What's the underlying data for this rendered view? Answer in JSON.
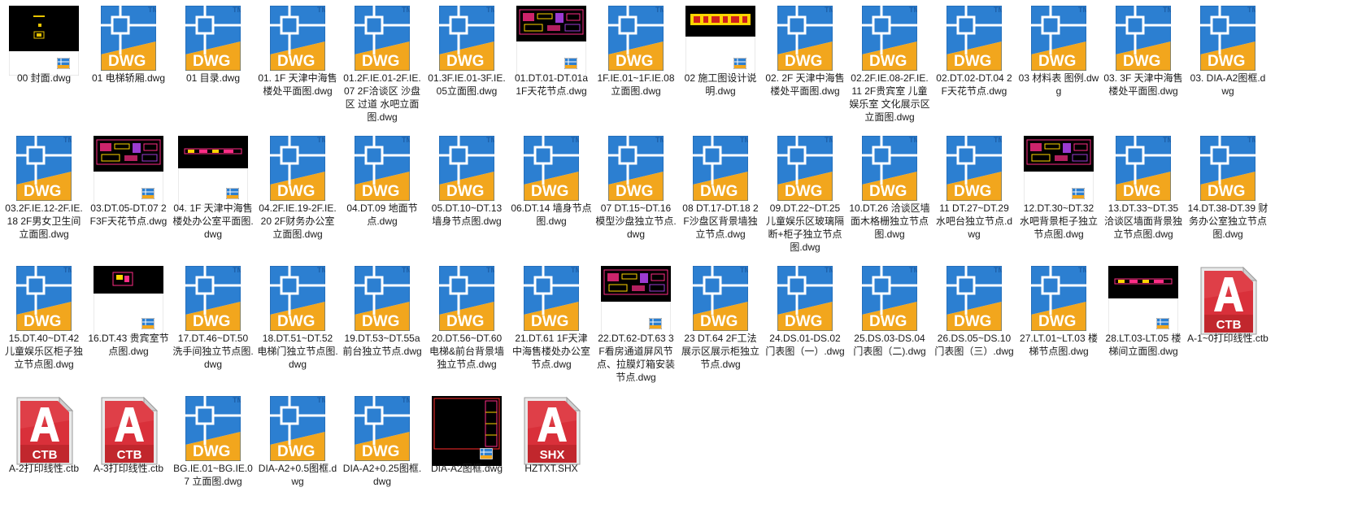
{
  "colors": {
    "dwg_blue": "#2c7fd1",
    "dwg_orange": "#f2a61d",
    "autocad_red": "#c1272d"
  },
  "files": [
    {
      "name": "00 封面.dwg",
      "icon": "preview-dwg-icon",
      "variant": "cover"
    },
    {
      "name": "01 电梯轿厢.dwg",
      "icon": "dwg-file-icon"
    },
    {
      "name": "01 目录.dwg",
      "icon": "dwg-file-icon"
    },
    {
      "name": "01. 1F 天津中海售楼处平面图.dwg",
      "icon": "dwg-file-icon"
    },
    {
      "name": "01.2F.IE.01-2F.IE.07 2F洽谈区 沙盘区 过道 水吧立面图.dwg",
      "icon": "dwg-file-icon"
    },
    {
      "name": "01.3F.IE.01-3F.IE.05立面图.dwg",
      "icon": "dwg-file-icon"
    },
    {
      "name": "01.DT.01-DT.01a 1F天花节点.dwg",
      "icon": "preview-dwg-icon",
      "variant": "boxes"
    },
    {
      "name": "1F.IE.01~1F.IE.08立面图.dwg",
      "icon": "dwg-file-icon"
    },
    {
      "name": "02 施工图设计说明.dwg",
      "icon": "preview-dwg-icon",
      "variant": "text"
    },
    {
      "name": "02. 2F 天津中海售楼处平面图.dwg",
      "icon": "dwg-file-icon"
    },
    {
      "name": "02.2F.IE.08-2F.IE.11 2F贵宾室 儿童娱乐室 文化展示区立面图.dwg",
      "icon": "dwg-file-icon"
    },
    {
      "name": "02.DT.02-DT.04 2F天花节点.dwg",
      "icon": "dwg-file-icon"
    },
    {
      "name": "03 材料表 图例.dwg",
      "icon": "dwg-file-icon"
    },
    {
      "name": "03. 3F 天津中海售楼处平面图.dwg",
      "icon": "dwg-file-icon"
    },
    {
      "name": "03. DIA-A2图框.dwg",
      "icon": "dwg-file-icon"
    },
    {
      "name": "03.2F.IE.12-2F.IE.18 2F男女卫生间立面图.dwg",
      "icon": "dwg-file-icon"
    },
    {
      "name": "03.DT.05-DT.07 2F3F天花节点.dwg",
      "icon": "preview-dwg-icon",
      "variant": "boxes"
    },
    {
      "name": "04. 1F 天津中海售楼处办公室平面图.dwg",
      "icon": "preview-dwg-icon",
      "variant": "strip"
    },
    {
      "name": "04.2F.IE.19-2F.IE.20 2F财务办公室 立面图.dwg",
      "icon": "dwg-file-icon"
    },
    {
      "name": "04.DT.09 地面节点.dwg",
      "icon": "dwg-file-icon"
    },
    {
      "name": "05.DT.10~DT.13 墙身节点图.dwg",
      "icon": "dwg-file-icon"
    },
    {
      "name": "06.DT.14 墙身节点图.dwg",
      "icon": "dwg-file-icon"
    },
    {
      "name": "07 DT.15~DT.16 模型沙盘独立节点.dwg",
      "icon": "dwg-file-icon"
    },
    {
      "name": "08 DT.17-DT.18 2F沙盘区背景墙独立节点.dwg",
      "icon": "dwg-file-icon"
    },
    {
      "name": "09.DT.22~DT.25 儿童娱乐区玻璃隔断+柜子独立节点图.dwg",
      "icon": "dwg-file-icon"
    },
    {
      "name": "10.DT.26 洽谈区墙面木格栅独立节点图.dwg",
      "icon": "dwg-file-icon"
    },
    {
      "name": "11 DT.27~DT.29 水吧台独立节点.dwg",
      "icon": "dwg-file-icon"
    },
    {
      "name": "12.DT.30~DT.32 水吧背景柜子独立节点图.dwg",
      "icon": "preview-dwg-icon",
      "variant": "boxes"
    },
    {
      "name": "13.DT.33~DT.35 洽谈区墙面背景独立节点图.dwg",
      "icon": "dwg-file-icon"
    },
    {
      "name": "14.DT.38-DT.39 财务办公室独立节点图.dwg",
      "icon": "dwg-file-icon"
    },
    {
      "name": "15.DT.40~DT.42 儿童娱乐区柜子独立节点图.dwg",
      "icon": "dwg-file-icon"
    },
    {
      "name": "16.DT.43 贵宾室节点图.dwg",
      "icon": "preview-dwg-icon",
      "variant": "small"
    },
    {
      "name": "17.DT.46~DT.50 洗手间独立节点图.dwg",
      "icon": "dwg-file-icon"
    },
    {
      "name": "18.DT.51~DT.52 电梯门独立节点图.dwg",
      "icon": "dwg-file-icon"
    },
    {
      "name": "19.DT.53~DT.55a 前台独立节点.dwg",
      "icon": "dwg-file-icon"
    },
    {
      "name": "20.DT.56~DT.60 电梯&前台背景墙独立节点.dwg",
      "icon": "dwg-file-icon"
    },
    {
      "name": "21.DT.61 1F天津中海售楼处办公室节点.dwg",
      "icon": "dwg-file-icon"
    },
    {
      "name": "22.DT.62-DT.63 3F看房通道屏风节点、拉膜灯箱安装节点.dwg",
      "icon": "preview-dwg-icon",
      "variant": "boxes"
    },
    {
      "name": "23 DT.64 2F工法展示区展示柜独立节点.dwg",
      "icon": "dwg-file-icon"
    },
    {
      "name": "24.DS.01-DS.02 门表图（一）.dwg",
      "icon": "dwg-file-icon"
    },
    {
      "name": "25.DS.03-DS.04 门表图（二).dwg",
      "icon": "dwg-file-icon"
    },
    {
      "name": "26.DS.05~DS.10 门表图（三）.dwg",
      "icon": "dwg-file-icon"
    },
    {
      "name": "27.LT.01~LT.03 楼梯节点图.dwg",
      "icon": "dwg-file-icon"
    },
    {
      "name": "28.LT.03-LT.05 楼梯间立面图.dwg",
      "icon": "preview-dwg-icon",
      "variant": "strip"
    },
    {
      "name": "A-1~0打印线性.ctb",
      "icon": "autocad-file-icon",
      "badge": "CTB"
    },
    {
      "name": "A-2打印线性.ctb",
      "icon": "autocad-file-icon",
      "badge": "CTB"
    },
    {
      "name": "A-3打印线性.ctb",
      "icon": "autocad-file-icon",
      "badge": "CTB"
    },
    {
      "name": "BG.IE.01~BG.IE.07 立面图.dwg",
      "icon": "dwg-file-icon"
    },
    {
      "name": "DIA-A2+0.5图框.dwg",
      "icon": "dwg-file-icon"
    },
    {
      "name": "DIA-A2+0.25图框.dwg",
      "icon": "dwg-file-icon"
    },
    {
      "name": "DIA-A2图框.dwg",
      "icon": "preview-dwg-icon",
      "variant": "frame"
    },
    {
      "name": "HZTXT.SHX",
      "icon": "autocad-file-icon",
      "badge": "SHX"
    }
  ]
}
